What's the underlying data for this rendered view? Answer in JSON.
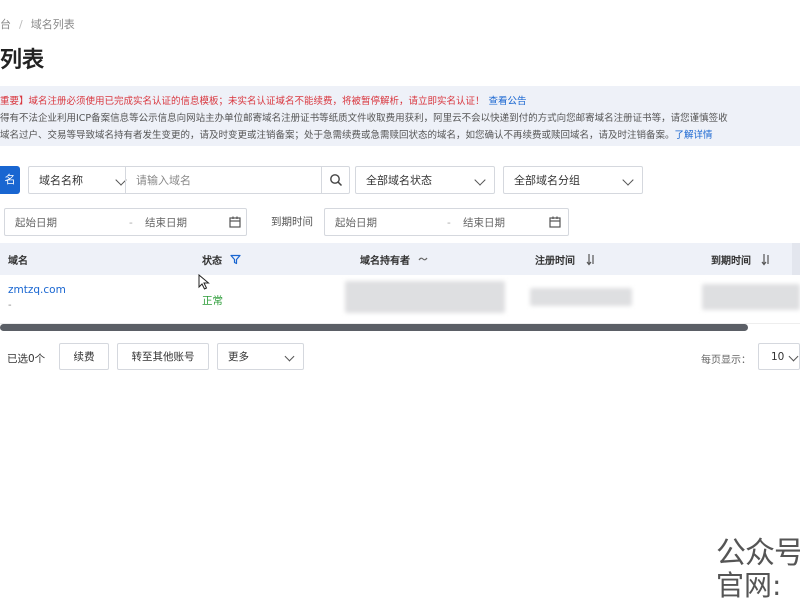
{
  "breadcrumb": {
    "parent": "台",
    "separator": "/",
    "current": "域名列表"
  },
  "page_title": "列表",
  "notice": {
    "line1": "重要】域名注册必须使用已完成实名认证的信息模板；未实名认证域名不能续费，将被暂停解析，请立即实名认证！",
    "line1_link": "查看公告",
    "line2": "得有不法企业利用ICP备案信息等公示信息向网站主办单位邮寄域名注册证书等纸质文件收取费用获利，阿里云不会以快递到付的方式向您邮寄域名注册证书等，请您谨慎签收",
    "line3": "域名过户、交易等导致域名持有者发生变更的，请及时变更或注销备案；处于急需续费或急需赎回状态的域名，如您确认不再续费或赎回域名，请及时注销备案。",
    "line3_link": "了解详情"
  },
  "filters": {
    "primary_button": "名",
    "search_type": "域名名称",
    "search_placeholder": "请输入域名",
    "status_select": "全部域名状态",
    "group_select": "全部域名分组",
    "start_date_placeholder": "起始日期",
    "end_date_placeholder": "结束日期",
    "expire_label": "到期时间",
    "expire_start_placeholder": "起始日期",
    "expire_end_placeholder": "结束日期",
    "date_separator": "-"
  },
  "table": {
    "columns": [
      "域名",
      "状态",
      "域名持有者",
      "注册时间",
      "到期时间"
    ],
    "rows": [
      {
        "domain": "zmtzq.com",
        "sub": "-",
        "status": "正常"
      }
    ]
  },
  "footer": {
    "selected": "已选0个",
    "renew_button": "续费",
    "transfer_button": "转至其他账号",
    "more_select": "更多",
    "page_size_label": "每页显示：",
    "page_size": "10"
  },
  "watermark": {
    "line1": "公众号",
    "line2": "官网:"
  },
  "colors": {
    "accent": "#1966d1",
    "status_ok": "#2e9d3a",
    "warning": "#d9363e",
    "header_bg": "#eef1f8"
  }
}
